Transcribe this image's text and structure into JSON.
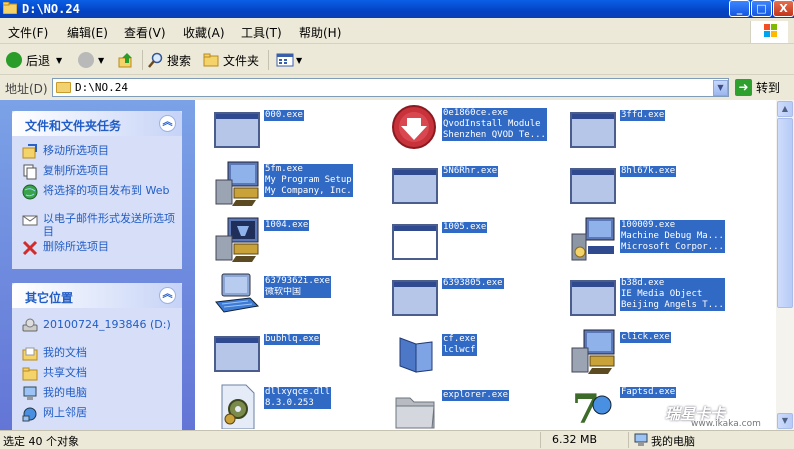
{
  "window": {
    "title": "D:\\NO.24",
    "buttons": {
      "minimize": "_",
      "maximize": "□",
      "close": "X"
    }
  },
  "menu": [
    "文件(F)",
    "编辑(E)",
    "查看(V)",
    "收藏(A)",
    "工具(T)",
    "帮助(H)"
  ],
  "toolbar": {
    "back": "后退",
    "search": "搜索",
    "folders": "文件夹"
  },
  "address": {
    "label": "地址(D)",
    "value": "D:\\NO.24",
    "go": "转到"
  },
  "tasks": {
    "title": "文件和文件夹任务",
    "items": [
      "移动所选项目",
      "复制所选项目",
      "将选择的项目发布到 Web",
      "以电子邮件形式发送所选项目",
      "删除所选项目"
    ]
  },
  "places": {
    "title": "其它位置",
    "items": [
      "20100724_193846 (D:)",
      "我的文档",
      "共享文档",
      "我的电脑",
      "网上邻居"
    ]
  },
  "files": [
    {
      "name": [
        "000.exe"
      ],
      "icon": "window-icon"
    },
    {
      "name": [
        "0e1860ce.exe",
        "QvodInstall Module",
        "Shenzhen QVOD Te..."
      ],
      "icon": "red-download-icon"
    },
    {
      "name": [
        "3ffd.exe"
      ],
      "icon": "window-icon"
    },
    {
      "name": [
        "5fm.exe",
        "My Program Setup",
        "My Company, Inc."
      ],
      "icon": "setup-computer-icon"
    },
    {
      "name": [
        "5N6Rhr.exe"
      ],
      "icon": "window-icon"
    },
    {
      "name": [
        "8hl67k.exe"
      ],
      "icon": "window-icon"
    },
    {
      "name": [
        "1004.exe"
      ],
      "icon": "setup-computer-icon"
    },
    {
      "name": [
        "1005.exe"
      ],
      "icon": "blank-window-icon"
    },
    {
      "name": [
        "100009.exe",
        "Machine Debug Ma...",
        "Microsoft Corpor..."
      ],
      "icon": "debug-computer-icon"
    },
    {
      "name": [
        "6379362i.exe",
        "微软中国"
      ],
      "icon": "keyboard-computer-icon"
    },
    {
      "name": [
        "6393805.exe"
      ],
      "icon": "window-icon"
    },
    {
      "name": [
        "b38d.exe",
        "IE Media Object",
        "Beijing Angels T..."
      ],
      "icon": "window-icon"
    },
    {
      "name": [
        "bubhlq.exe"
      ],
      "icon": "window-icon"
    },
    {
      "name": [
        "cf.exe",
        "lclwcf"
      ],
      "icon": "folder-blue-icon"
    },
    {
      "name": [
        "click.exe"
      ],
      "icon": "setup-computer-icon"
    },
    {
      "name": [
        "dllxyqce.dll",
        "8.3.0.253"
      ],
      "icon": "dll-gear-icon"
    },
    {
      "name": [
        "explorer.exe"
      ],
      "icon": "folder-gray-icon"
    },
    {
      "name": [
        "Faptsd.exe"
      ],
      "icon": "seven-zip-icon"
    }
  ],
  "status": {
    "selected": "选定 40 个对象",
    "size": "6.32 MB",
    "location": "我的电脑"
  },
  "watermark": {
    "brand": "瑞星卡卡",
    "url": "www.ikaka.com"
  },
  "colors": {
    "selection": "#316ac5",
    "title_bar": "#0a5fe6",
    "task_link": "#215dc6"
  }
}
